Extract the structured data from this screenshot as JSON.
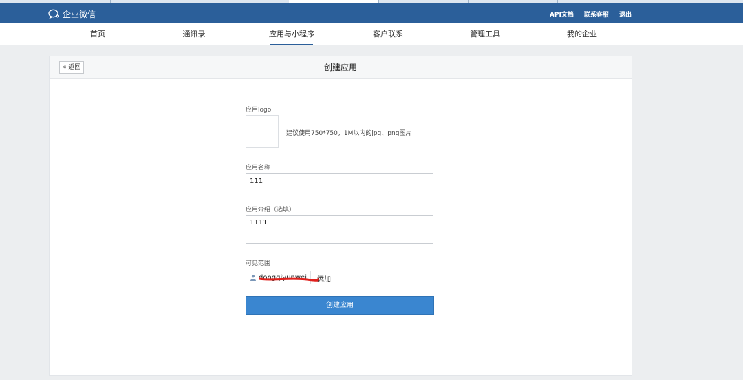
{
  "app": {
    "name": "企业微信"
  },
  "topbar": {
    "links": [
      {
        "label": "API文档"
      },
      {
        "label": "联系客服"
      },
      {
        "label": "退出"
      }
    ],
    "separator": "|"
  },
  "nav": {
    "items": [
      {
        "label": "首页"
      },
      {
        "label": "通讯录"
      },
      {
        "label": "应用与小程序",
        "active": true
      },
      {
        "label": "客户联系"
      },
      {
        "label": "管理工具"
      },
      {
        "label": "我的企业"
      }
    ]
  },
  "page": {
    "back_label": "« 返回",
    "title": "创建应用"
  },
  "form": {
    "logo": {
      "label": "应用logo",
      "hint": "建议使用750*750，1M以内的jpg、png图片"
    },
    "name": {
      "label": "应用名称",
      "value": "111"
    },
    "description": {
      "label": "应用介绍（选填）",
      "value": "1111"
    },
    "visibility": {
      "label": "可见范围",
      "member": "dongqiyunwei",
      "add_label": "添加"
    },
    "submit_label": "创建应用"
  },
  "colors": {
    "topbar": "#2b5f9a",
    "primary": "#3a86d0",
    "redaction": "#e0201c"
  }
}
